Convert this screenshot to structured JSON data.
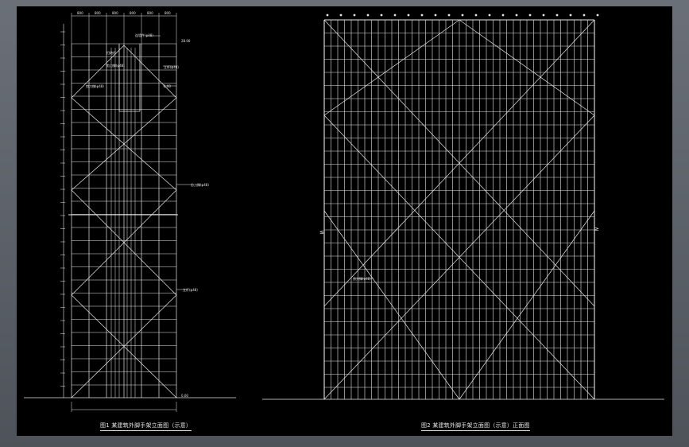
{
  "left_caption": "图1 某建筑外脚手架立面图（示意）",
  "right_caption": "图2 某建筑外脚手架立面图（示意）正面图",
  "left_top_dims": [
    "800",
    "800",
    "800",
    "800",
    "800",
    "800"
  ],
  "level_labels": [
    "28.00",
    "0.00"
  ],
  "callouts": {
    "top_a": "连墙件(φ48)",
    "top_b": "扫地杆",
    "top_c": "剪刀撑(φ48)",
    "top_d": "立杆(φ48)",
    "top_e": "2.00",
    "top_f": "剪刀撑(φ48)",
    "mid_a": "剪刀撑(φ48)",
    "low_a": "立杆(φ48)",
    "right_a": "剪刀撑(φ48)"
  },
  "colors": {
    "line": "#e6e6e6",
    "bg": "#000000"
  }
}
